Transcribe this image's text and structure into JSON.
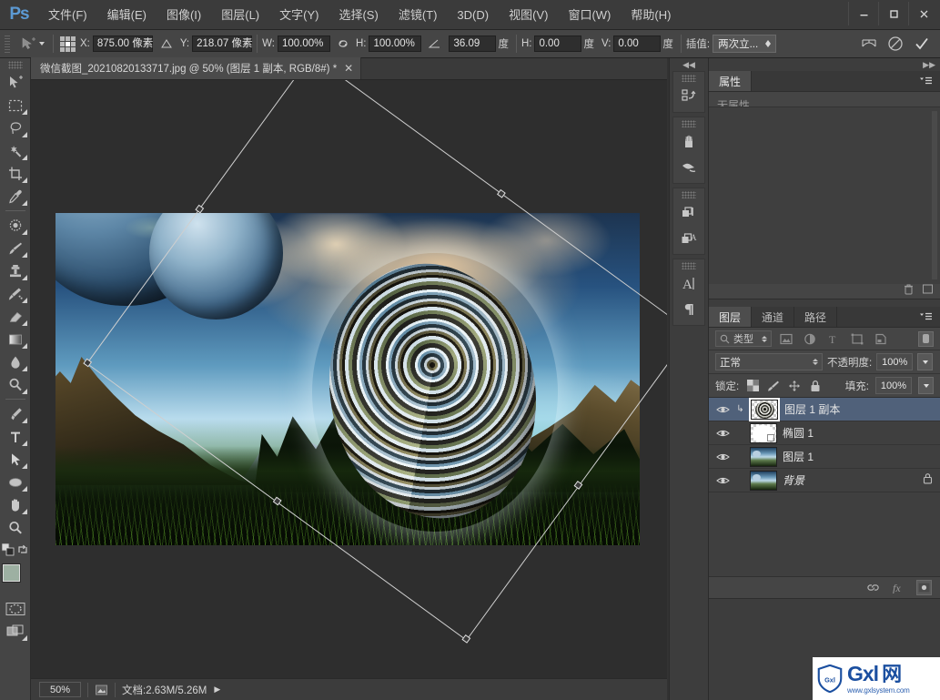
{
  "app": {
    "logo": "Ps"
  },
  "menubar": {
    "items": [
      {
        "label": "文件(F)"
      },
      {
        "label": "编辑(E)"
      },
      {
        "label": "图像(I)"
      },
      {
        "label": "图层(L)"
      },
      {
        "label": "文字(Y)"
      },
      {
        "label": "选择(S)"
      },
      {
        "label": "滤镜(T)"
      },
      {
        "label": "3D(D)"
      },
      {
        "label": "视图(V)"
      },
      {
        "label": "窗口(W)"
      },
      {
        "label": "帮助(H)"
      }
    ],
    "window_controls": [
      {
        "name": "minimize"
      },
      {
        "name": "maximize"
      },
      {
        "name": "close"
      }
    ]
  },
  "options_bar": {
    "tool_preset_icon": "move-tool-preset-icon",
    "reference_point_icon": "reference-point-grid-icon",
    "x_label": "X:",
    "x_value": "875.00 像素",
    "delta_icon": "delta-triangle-icon",
    "y_label": "Y:",
    "y_value": "218.07 像素",
    "w_label": "W:",
    "w_value": "100.00%",
    "link_icon": "chain-link-icon",
    "h_label": "H:",
    "h_value": "100.00%",
    "angle_icon": "angle-icon",
    "angle_value": "36.09",
    "angle_unit": "度",
    "skew_h_label": "H:",
    "skew_h_value": "0.00",
    "skew_h_unit": "度",
    "skew_v_label": "V:",
    "skew_v_value": "0.00",
    "skew_v_unit": "度",
    "interp_label": "插值:",
    "interp_value": "两次立...",
    "warp_icon": "warp-mode-icon",
    "cancel_icon": "cancel-transform-icon",
    "commit_icon": "commit-transform-icon"
  },
  "toolbar": {
    "tools": [
      {
        "name": "move-tool",
        "icon": "move-arrow-icon",
        "more": false,
        "selected": false
      },
      {
        "name": "rectangular-marquee-tool",
        "icon": "marquee-rect-icon",
        "more": true,
        "selected": false
      },
      {
        "name": "lasso-tool",
        "icon": "lasso-icon",
        "more": true,
        "selected": false
      },
      {
        "name": "magic-wand-tool",
        "icon": "magic-wand-icon",
        "more": true,
        "selected": false
      },
      {
        "name": "crop-tool",
        "icon": "crop-icon",
        "more": true,
        "selected": false
      },
      {
        "name": "eyedropper-tool",
        "icon": "eyedropper-icon",
        "more": true,
        "selected": false
      },
      {
        "name": "spot-healing-tool",
        "icon": "spot-healing-icon",
        "more": true,
        "selected": false
      },
      {
        "name": "brush-tool",
        "icon": "brush-icon",
        "more": true,
        "selected": false
      },
      {
        "name": "clone-stamp-tool",
        "icon": "clone-stamp-icon",
        "more": true,
        "selected": false
      },
      {
        "name": "history-brush-tool",
        "icon": "history-brush-icon",
        "more": true,
        "selected": false
      },
      {
        "name": "eraser-tool",
        "icon": "eraser-icon",
        "more": true,
        "selected": false
      },
      {
        "name": "gradient-tool",
        "icon": "gradient-icon",
        "more": true,
        "selected": false
      },
      {
        "name": "blur-tool",
        "icon": "blur-drop-icon",
        "more": true,
        "selected": false
      },
      {
        "name": "dodge-tool",
        "icon": "dodge-icon",
        "more": true,
        "selected": false
      },
      {
        "name": "pen-tool",
        "icon": "pen-icon",
        "more": true,
        "selected": false
      },
      {
        "name": "type-tool",
        "icon": "type-t-icon",
        "more": true,
        "selected": false
      },
      {
        "name": "path-selection-tool",
        "icon": "path-arrow-icon",
        "more": true,
        "selected": false
      },
      {
        "name": "ellipse-shape-tool",
        "icon": "ellipse-icon",
        "more": true,
        "selected": false
      },
      {
        "name": "hand-tool",
        "icon": "hand-icon",
        "more": true,
        "selected": false
      },
      {
        "name": "zoom-tool",
        "icon": "zoom-magnifier-icon",
        "more": false,
        "selected": false
      }
    ],
    "default_colors_icon": "default-colors-icon",
    "swap_colors_icon": "swap-colors-icon",
    "foreground_color": "#9db0a2",
    "background_color": "#000000",
    "quickmask_icon": "quick-mask-icon",
    "screenmode_icon": "screen-mode-icon"
  },
  "document": {
    "tab_title": "微信截图_20210820133717.jpg @ 50% (图层 1 副本, RGB/8#) *",
    "close_icon": "close-icon"
  },
  "statusbar": {
    "zoom": "50%",
    "preview_icon": "thumbnail-preview-icon",
    "doc_info": "文档:2.63M/5.26M",
    "expand_icon": "expand-arrow-icon"
  },
  "icon_dock": {
    "collapse_icon": "collapse-panels-icon",
    "groups": [
      {
        "icons": [
          {
            "name": "history-panel-icon"
          }
        ]
      },
      {
        "icons": [
          {
            "name": "brush-presets-panel-icon"
          },
          {
            "name": "brush-panel-icon"
          }
        ]
      },
      {
        "icons": [
          {
            "name": "layer-comps-panel-icon"
          },
          {
            "name": "character-styles-panel-icon"
          }
        ]
      },
      {
        "icons": [
          {
            "name": "character-panel-icon"
          },
          {
            "name": "paragraph-panel-icon"
          }
        ]
      }
    ]
  },
  "properties_panel": {
    "expand_icon": "expand-panels-icon",
    "tabs": [
      {
        "label": "属性",
        "active": true
      }
    ],
    "menu_icon": "panel-menu-icon",
    "empty_text": "无属性",
    "footer_icons": [
      {
        "name": "delete-icon"
      },
      {
        "name": "panel-options-icon"
      }
    ]
  },
  "layers_panel": {
    "tabs": [
      {
        "label": "图层",
        "active": true
      },
      {
        "label": "通道",
        "active": false
      },
      {
        "label": "路径",
        "active": false
      }
    ],
    "menu_icon": "panel-menu-icon",
    "filter": {
      "search_icon": "search-icon",
      "type_label": "类型",
      "icons": [
        {
          "name": "filter-pixel-icon"
        },
        {
          "name": "filter-adjustment-icon"
        },
        {
          "name": "filter-type-icon"
        },
        {
          "name": "filter-shape-icon"
        },
        {
          "name": "filter-smart-object-icon"
        }
      ],
      "toggle_icon": "filter-toggle-icon"
    },
    "blend_mode": "正常",
    "opacity_label": "不透明度:",
    "opacity_value": "100%",
    "lock_label": "锁定:",
    "lock_icons": [
      {
        "name": "lock-transparent-pixels-icon"
      },
      {
        "name": "lock-image-pixels-icon"
      },
      {
        "name": "lock-position-icon"
      },
      {
        "name": "lock-all-icon"
      }
    ],
    "fill_label": "填充:",
    "fill_value": "100%",
    "layers": [
      {
        "name": "图层 1 副本",
        "visible": true,
        "selected": true,
        "thumb": "swirl",
        "linked": true,
        "locked": false,
        "italic": false
      },
      {
        "name": "椭圆 1",
        "visible": true,
        "selected": false,
        "thumb": "shape",
        "linked": false,
        "locked": false,
        "italic": false
      },
      {
        "name": "图层 1",
        "visible": true,
        "selected": false,
        "thumb": "photo",
        "linked": false,
        "locked": false,
        "italic": false
      },
      {
        "name": "背景",
        "visible": true,
        "selected": false,
        "thumb": "photo",
        "linked": false,
        "locked": true,
        "italic": true
      }
    ],
    "footer_icons": [
      {
        "name": "link-layers-icon"
      },
      {
        "name": "layer-style-fx-icon"
      },
      {
        "name": "add-layer-mask-icon"
      }
    ]
  },
  "canvas": {
    "zoom_percent": "50%",
    "transform": {
      "angle_deg": "36.09",
      "handles": [
        "top-left",
        "top-center",
        "top-right",
        "middle-left",
        "middle-right",
        "bottom-left",
        "bottom-center",
        "bottom-right"
      ]
    }
  },
  "watermark": {
    "shield_text": "Gxl",
    "brand": "Gxl",
    "brand_cn": "网",
    "url": "www.gxlsystem.com",
    "color": "#1b4fa0"
  }
}
